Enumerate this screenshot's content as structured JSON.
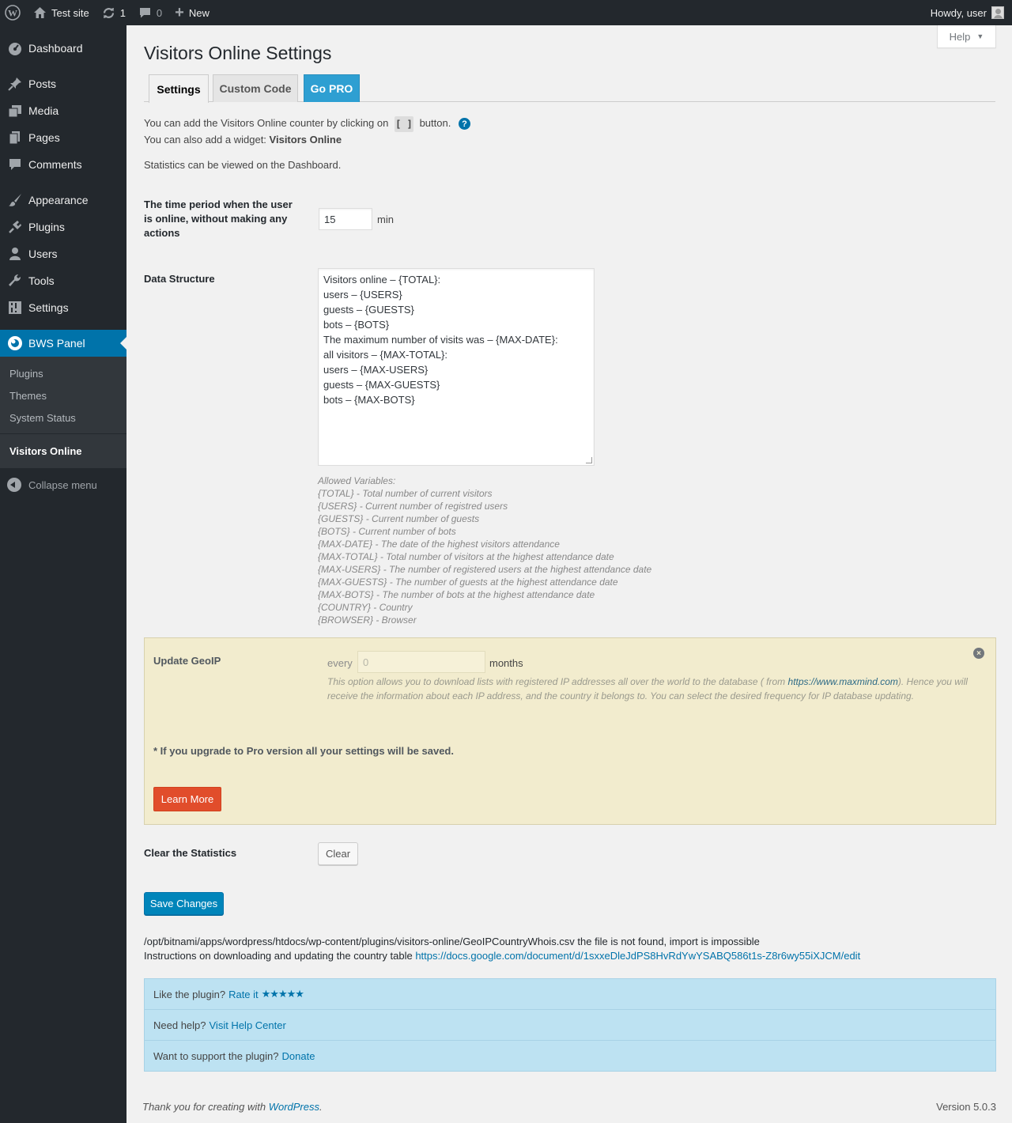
{
  "adminbar": {
    "site_name": "Test site",
    "updates_count": "1",
    "comments_count": "0",
    "new_label": "New",
    "howdy": "Howdy, user"
  },
  "sidebar": {
    "items": [
      {
        "label": "Dashboard",
        "icon": "dashboard-icon"
      },
      {
        "label": "Posts",
        "icon": "pin-icon"
      },
      {
        "label": "Media",
        "icon": "media-icon"
      },
      {
        "label": "Pages",
        "icon": "page-icon"
      },
      {
        "label": "Comments",
        "icon": "comment-icon"
      },
      {
        "label": "Appearance",
        "icon": "brush-icon"
      },
      {
        "label": "Plugins",
        "icon": "plug-icon"
      },
      {
        "label": "Users",
        "icon": "user-icon"
      },
      {
        "label": "Tools",
        "icon": "wrench-icon"
      },
      {
        "label": "Settings",
        "icon": "settings-icon"
      },
      {
        "label": "BWS Panel",
        "icon": "bws-icon"
      }
    ],
    "submenu": [
      "Plugins",
      "Themes",
      "System Status"
    ],
    "current_sub": "Visitors Online",
    "collapse": "Collapse menu"
  },
  "help_tab": "Help",
  "page": {
    "title": "Visitors Online Settings",
    "tabs": [
      "Settings",
      "Custom Code",
      "Go PRO"
    ],
    "intro_line1_a": "You can add the Visitors Online counter by clicking on",
    "intro_code": "[ ]",
    "intro_line1_b": "button.",
    "intro_line2_a": "You can also add a widget:",
    "intro_line2_b": "Visitors Online",
    "intro_line3": "Statistics can be viewed on the Dashboard."
  },
  "fields": {
    "time_label": "The time period when the user is online, without making any actions",
    "time_value": "15",
    "time_unit": "min",
    "data_structure_label": "Data Structure",
    "data_structure_lines": [
      "Visitors online – {TOTAL}:",
      "users – {USERS}",
      "guests – {GUESTS}",
      "bots – {BOTS}",
      "The maximum number of visits was – {MAX-DATE}:",
      "all visitors – {MAX-TOTAL}:",
      "users – {MAX-USERS}",
      "guests – {MAX-GUESTS}",
      "bots – {MAX-BOTS}"
    ],
    "allowed_variables": [
      "Allowed Variables:",
      "{TOTAL} - Total number of current visitors",
      "{USERS} - Current number of registred users",
      "{GUESTS} - Current number of guests",
      "{BOTS} - Current number of bots",
      "{MAX-DATE} - The date of the highest visitors attendance",
      "{MAX-TOTAL} - Total number of visitors at the highest attendance date",
      "{MAX-USERS} - The number of registered users at the highest attendance date",
      "{MAX-GUESTS} - The number of guests at the highest attendance date",
      "{MAX-BOTS} - The number of bots at the highest attendance date",
      "{COUNTRY} - Country",
      "{BROWSER} - Browser"
    ]
  },
  "pro_box": {
    "label": "Update GeoIP",
    "every": "every",
    "value": "0",
    "months": "months",
    "desc_a": "This option allows you to download lists with registered IP addresses all over the world to the database ( from ",
    "desc_link": "https://www.maxmind.com",
    "desc_b": "). Hence you will receive the information about each IP address, and the country it belongs to. You can select the desired frequency for IP database updating.",
    "note": "* If you upgrade to Pro version all your settings will be saved.",
    "learn_more": "Learn More",
    "close": "×"
  },
  "clear": {
    "label": "Clear the Statistics",
    "button": "Clear"
  },
  "save_button": "Save Changes",
  "notice": {
    "line1": "/opt/bitnami/apps/wordpress/htdocs/wp-content/plugins/visitors-online/GeoIPCountryWhois.csv the file is not found, import is impossible",
    "line2": "Instructions on downloading and updating the country table",
    "link": "https://docs.google.com/document/d/1sxxeDleJdPS8HvRdYwYSABQ586t1s-Z8r6wy55iXJCM/edit"
  },
  "rate_box": {
    "row1_text": "Like the plugin?",
    "row1_link": "Rate it",
    "stars": "★★★★★",
    "row2_text": "Need help?",
    "row2_link": "Visit Help Center",
    "row3_text": "Want to support the plugin?",
    "row3_link": "Donate"
  },
  "footer": {
    "thanks": "Thank you for creating with",
    "wp_link": "WordPress",
    "version": "Version 5.0.3"
  }
}
